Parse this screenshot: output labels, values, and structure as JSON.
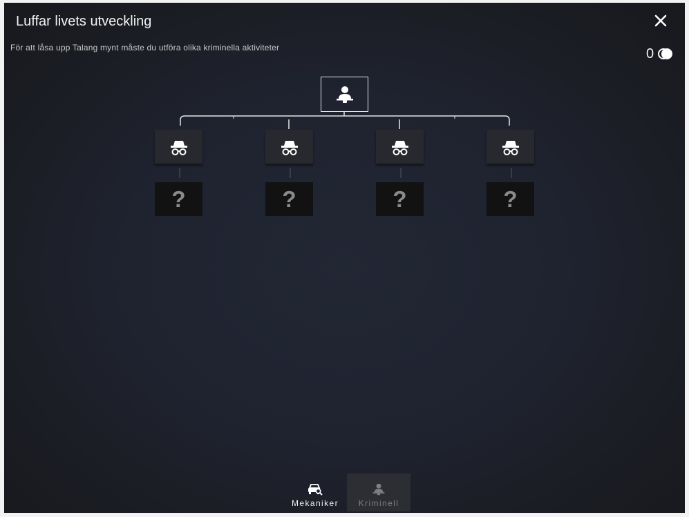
{
  "window": {
    "title": "Luffar livets utveckling",
    "subtitle": "För att låsa upp Talang mynt måste du utföra olika kriminella aktiviteter",
    "coin_count": "0"
  },
  "tree": {
    "root_icon": "criminal-person-icon",
    "talent_icon": "spy-incognito-icon",
    "locked_label": "?",
    "branches": [
      {
        "talent": "spy-incognito-icon",
        "locked": "?"
      },
      {
        "talent": "spy-incognito-icon",
        "locked": "?"
      },
      {
        "talent": "spy-incognito-icon",
        "locked": "?"
      },
      {
        "talent": "spy-incognito-icon",
        "locked": "?"
      }
    ]
  },
  "tabs": [
    {
      "label": "Mekaniker",
      "icon": "car-wrench-icon",
      "active": true
    },
    {
      "label": "Kriminell",
      "icon": "criminal-person-icon",
      "active": false
    }
  ],
  "colors": {
    "background": "#1f2330",
    "text": "#f1f1f1",
    "talent_box": "#27292e",
    "locked_box": "#121212"
  }
}
